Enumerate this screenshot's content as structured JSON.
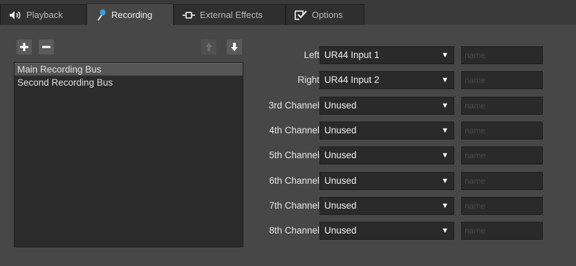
{
  "tabs": [
    {
      "label": "Playback",
      "icon": "speaker-icon"
    },
    {
      "label": "Recording",
      "icon": "microphone-icon"
    },
    {
      "label": "External Effects",
      "icon": "plug-icon"
    },
    {
      "label": "Options",
      "icon": "checkmark-icon"
    }
  ],
  "active_tab": "Recording",
  "toolbar": {
    "add": "add-icon",
    "remove": "remove-icon",
    "up": "arrow-up-icon",
    "down": "arrow-down-icon"
  },
  "buses": [
    {
      "label": "Main Recording Bus",
      "selected": true
    },
    {
      "label": "Second Recording Bus",
      "selected": false
    }
  ],
  "channels": [
    {
      "label": "Left",
      "value": "UR44 Input 1",
      "placeholder": "name"
    },
    {
      "label": "Right",
      "value": "UR44 Input 2",
      "placeholder": "name"
    },
    {
      "label": "3rd Channel",
      "value": "Unused",
      "placeholder": "name"
    },
    {
      "label": "4th Channel",
      "value": "Unused",
      "placeholder": "name"
    },
    {
      "label": "5th Channel",
      "value": "Unused",
      "placeholder": "name"
    },
    {
      "label": "6th Channel",
      "value": "Unused",
      "placeholder": "name"
    },
    {
      "label": "7th Channel",
      "value": "Unused",
      "placeholder": "name"
    },
    {
      "label": "8th Channel",
      "value": "Unused",
      "placeholder": "name"
    }
  ],
  "colors": {
    "accent": "#3ea0e0",
    "panel": "#474747",
    "field": "#2a2a2a"
  }
}
